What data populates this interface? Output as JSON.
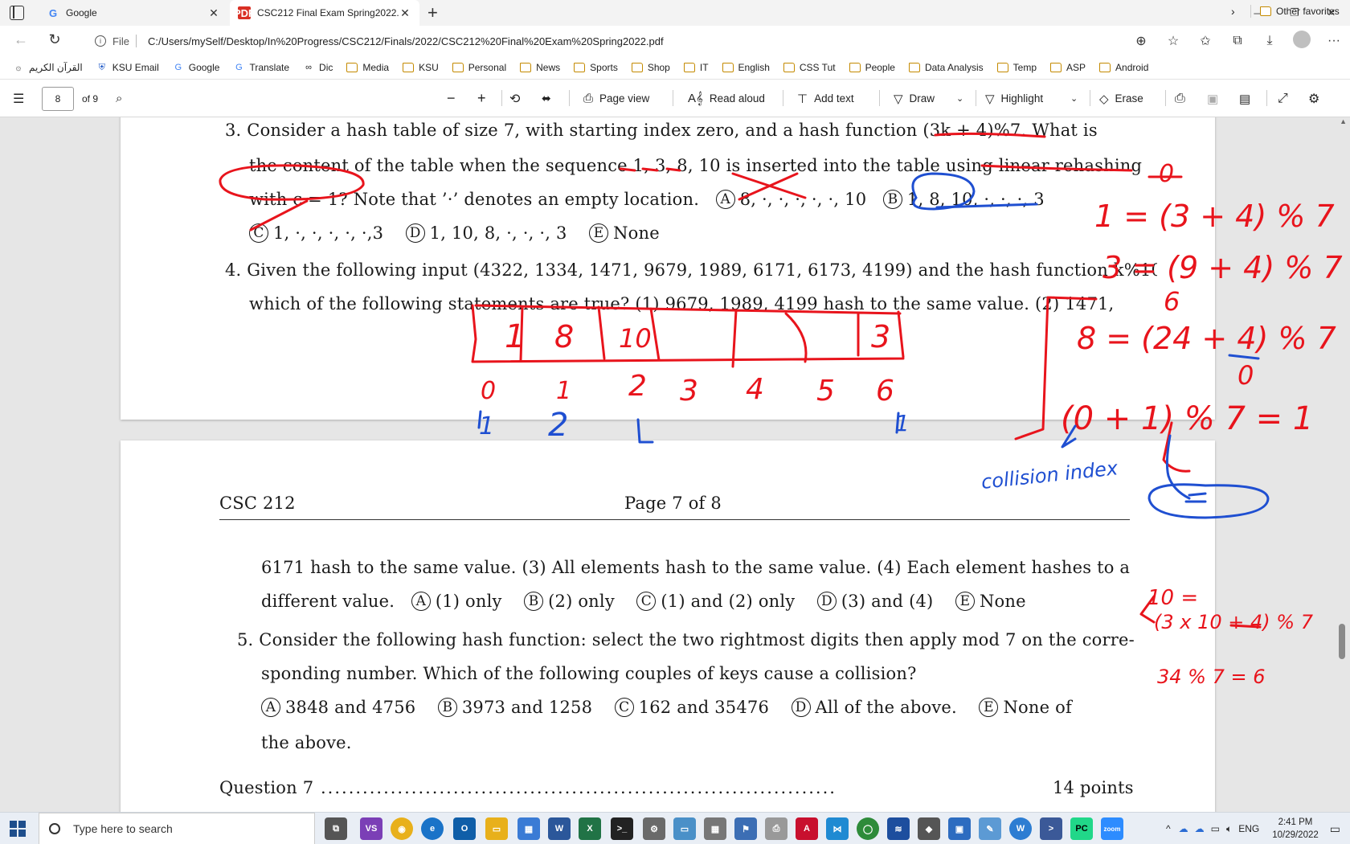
{
  "browser": {
    "tabs": [
      {
        "title": "Google",
        "icon": "google-icon"
      },
      {
        "title": "CSC212 Final Exam Spring2022.p",
        "icon": "pdf-icon"
      }
    ],
    "address": {
      "scheme": "File",
      "url": "C:/Users/mySelf/Desktop/In%20Progress/CSC212/Finals/2022/CSC212%20Final%20Exam%20Spring2022.pdf"
    },
    "bookmarks": [
      {
        "label": "القرآن الكريم",
        "icon": "quran-icon"
      },
      {
        "label": "KSU Email",
        "icon": "shield-icon"
      },
      {
        "label": "Google",
        "icon": "google-icon"
      },
      {
        "label": "Translate",
        "icon": "translate-icon"
      },
      {
        "label": "Dic",
        "icon": "dictionary-icon"
      },
      {
        "label": "Media",
        "icon": "folder-icon"
      },
      {
        "label": "KSU",
        "icon": "folder-icon"
      },
      {
        "label": "Personal",
        "icon": "folder-icon"
      },
      {
        "label": "News",
        "icon": "folder-icon"
      },
      {
        "label": "Sports",
        "icon": "folder-icon"
      },
      {
        "label": "Shop",
        "icon": "folder-icon"
      },
      {
        "label": "IT",
        "icon": "folder-icon"
      },
      {
        "label": "English",
        "icon": "folder-icon"
      },
      {
        "label": "CSS Tut",
        "icon": "folder-icon"
      },
      {
        "label": "People",
        "icon": "folder-icon"
      },
      {
        "label": "Data Analysis",
        "icon": "folder-icon"
      },
      {
        "label": "Temp",
        "icon": "folder-icon"
      },
      {
        "label": "ASP",
        "icon": "folder-icon"
      },
      {
        "label": "Android",
        "icon": "folder-icon"
      }
    ],
    "other_favorites": "Other favorites"
  },
  "pdf_toolbar": {
    "page_number": "8",
    "page_total": "of 9",
    "page_view": "Page view",
    "read_aloud": "Read aloud",
    "add_text": "Add text",
    "draw": "Draw",
    "highlight": "Highlight",
    "erase": "Erase"
  },
  "document": {
    "q3": {
      "line1": "3.  Consider a hash table of size 7, with starting index zero, and a hash function (3k + 4)%7.  What is",
      "line2": "the content of the table when the sequence 1, 3, 8, 10 is inserted into the table using linear rehashing",
      "line3": "with c = 1?  Note that ’·’ denotes an empty location.",
      "optA": "8, ·, ·, ·, ·, ·, 10",
      "optB": "1, 8, 10, ·, ·, ·, 3",
      "optC": "1, ·, ·, ·, ·, ·,3",
      "optD": "1, 10, 8, ·, ·, ·, 3",
      "optE": "None"
    },
    "q4": {
      "line1": "4.  Given the following input (4322, 1334, 1471, 9679, 1989, 6171, 6173, 4199) and the hash function k%10,",
      "line2": "which of the following statements are true?  (1) 9679, 1989, 4199 hash to the same value.  (2) 1471,",
      "line3": "6171 hash to the same value.  (3) All elements hash to the same value.  (4) Each element hashes to a",
      "line4_prefix": "different value.",
      "optA": "(1) only",
      "optB": "(2) only",
      "optC": "(1) and (2) only",
      "optD": "(3) and (4)",
      "optE": "None"
    },
    "footer": {
      "course": "CSC 212",
      "page": "Page 7 of 8"
    },
    "q5": {
      "line1": "5.  Consider the following hash function: select the two rightmost digits then apply mod 7 on the corre-",
      "line2": "sponding number.  Which of the following couples of keys cause a collision?",
      "optA": "3848 and 4756",
      "optB": "3973 and 1258",
      "optC": "162 and 35476",
      "optD": "All of the above.",
      "optE": "None of",
      "line4": "the above."
    },
    "q7": {
      "label": "Question 7",
      "points": "14 points"
    }
  },
  "annotations": {
    "table_cells": [
      "1",
      "8",
      "10",
      "",
      "",
      "",
      "3"
    ],
    "indices": [
      "0",
      "1",
      "2",
      "3",
      "4",
      "5",
      "6"
    ],
    "probe_counts": [
      "1",
      "2",
      "1",
      "",
      "",
      "",
      "1"
    ],
    "right_work": [
      "0",
      "1 = (3 + 4) % 7",
      "3 = (9 + 4) % 7",
      "6",
      "8 = (24 + 4) % 7",
      "0",
      "(0 + 1) % 7 = 1",
      "10 =",
      "(3 x 10 + 4) % 7",
      "34 % 7 = 6"
    ],
    "collision_note": "collision index",
    "colors": {
      "red": "#e8141c",
      "blue": "#1f4fd1"
    }
  },
  "taskbar": {
    "search_placeholder": "Type here to search",
    "language": "ENG",
    "time": "2:41 PM",
    "date": "10/29/2022"
  }
}
